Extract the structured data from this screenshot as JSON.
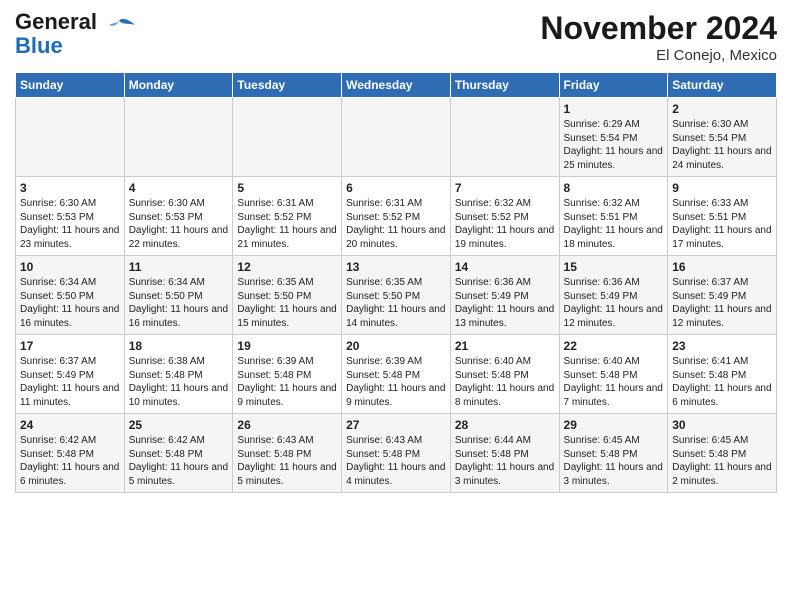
{
  "header": {
    "logo_line1": "General",
    "logo_line2": "Blue",
    "title": "November 2024",
    "subtitle": "El Conejo, Mexico"
  },
  "days_of_week": [
    "Sunday",
    "Monday",
    "Tuesday",
    "Wednesday",
    "Thursday",
    "Friday",
    "Saturday"
  ],
  "weeks": [
    [
      {
        "day": "",
        "info": ""
      },
      {
        "day": "",
        "info": ""
      },
      {
        "day": "",
        "info": ""
      },
      {
        "day": "",
        "info": ""
      },
      {
        "day": "",
        "info": ""
      },
      {
        "day": "1",
        "info": "Sunrise: 6:29 AM\nSunset: 5:54 PM\nDaylight: 11 hours and 25 minutes."
      },
      {
        "day": "2",
        "info": "Sunrise: 6:30 AM\nSunset: 5:54 PM\nDaylight: 11 hours and 24 minutes."
      }
    ],
    [
      {
        "day": "3",
        "info": "Sunrise: 6:30 AM\nSunset: 5:53 PM\nDaylight: 11 hours and 23 minutes."
      },
      {
        "day": "4",
        "info": "Sunrise: 6:30 AM\nSunset: 5:53 PM\nDaylight: 11 hours and 22 minutes."
      },
      {
        "day": "5",
        "info": "Sunrise: 6:31 AM\nSunset: 5:52 PM\nDaylight: 11 hours and 21 minutes."
      },
      {
        "day": "6",
        "info": "Sunrise: 6:31 AM\nSunset: 5:52 PM\nDaylight: 11 hours and 20 minutes."
      },
      {
        "day": "7",
        "info": "Sunrise: 6:32 AM\nSunset: 5:52 PM\nDaylight: 11 hours and 19 minutes."
      },
      {
        "day": "8",
        "info": "Sunrise: 6:32 AM\nSunset: 5:51 PM\nDaylight: 11 hours and 18 minutes."
      },
      {
        "day": "9",
        "info": "Sunrise: 6:33 AM\nSunset: 5:51 PM\nDaylight: 11 hours and 17 minutes."
      }
    ],
    [
      {
        "day": "10",
        "info": "Sunrise: 6:34 AM\nSunset: 5:50 PM\nDaylight: 11 hours and 16 minutes."
      },
      {
        "day": "11",
        "info": "Sunrise: 6:34 AM\nSunset: 5:50 PM\nDaylight: 11 hours and 16 minutes."
      },
      {
        "day": "12",
        "info": "Sunrise: 6:35 AM\nSunset: 5:50 PM\nDaylight: 11 hours and 15 minutes."
      },
      {
        "day": "13",
        "info": "Sunrise: 6:35 AM\nSunset: 5:50 PM\nDaylight: 11 hours and 14 minutes."
      },
      {
        "day": "14",
        "info": "Sunrise: 6:36 AM\nSunset: 5:49 PM\nDaylight: 11 hours and 13 minutes."
      },
      {
        "day": "15",
        "info": "Sunrise: 6:36 AM\nSunset: 5:49 PM\nDaylight: 11 hours and 12 minutes."
      },
      {
        "day": "16",
        "info": "Sunrise: 6:37 AM\nSunset: 5:49 PM\nDaylight: 11 hours and 12 minutes."
      }
    ],
    [
      {
        "day": "17",
        "info": "Sunrise: 6:37 AM\nSunset: 5:49 PM\nDaylight: 11 hours and 11 minutes."
      },
      {
        "day": "18",
        "info": "Sunrise: 6:38 AM\nSunset: 5:48 PM\nDaylight: 11 hours and 10 minutes."
      },
      {
        "day": "19",
        "info": "Sunrise: 6:39 AM\nSunset: 5:48 PM\nDaylight: 11 hours and 9 minutes."
      },
      {
        "day": "20",
        "info": "Sunrise: 6:39 AM\nSunset: 5:48 PM\nDaylight: 11 hours and 9 minutes."
      },
      {
        "day": "21",
        "info": "Sunrise: 6:40 AM\nSunset: 5:48 PM\nDaylight: 11 hours and 8 minutes."
      },
      {
        "day": "22",
        "info": "Sunrise: 6:40 AM\nSunset: 5:48 PM\nDaylight: 11 hours and 7 minutes."
      },
      {
        "day": "23",
        "info": "Sunrise: 6:41 AM\nSunset: 5:48 PM\nDaylight: 11 hours and 6 minutes."
      }
    ],
    [
      {
        "day": "24",
        "info": "Sunrise: 6:42 AM\nSunset: 5:48 PM\nDaylight: 11 hours and 6 minutes."
      },
      {
        "day": "25",
        "info": "Sunrise: 6:42 AM\nSunset: 5:48 PM\nDaylight: 11 hours and 5 minutes."
      },
      {
        "day": "26",
        "info": "Sunrise: 6:43 AM\nSunset: 5:48 PM\nDaylight: 11 hours and 5 minutes."
      },
      {
        "day": "27",
        "info": "Sunrise: 6:43 AM\nSunset: 5:48 PM\nDaylight: 11 hours and 4 minutes."
      },
      {
        "day": "28",
        "info": "Sunrise: 6:44 AM\nSunset: 5:48 PM\nDaylight: 11 hours and 3 minutes."
      },
      {
        "day": "29",
        "info": "Sunrise: 6:45 AM\nSunset: 5:48 PM\nDaylight: 11 hours and 3 minutes."
      },
      {
        "day": "30",
        "info": "Sunrise: 6:45 AM\nSunset: 5:48 PM\nDaylight: 11 hours and 2 minutes."
      }
    ]
  ]
}
